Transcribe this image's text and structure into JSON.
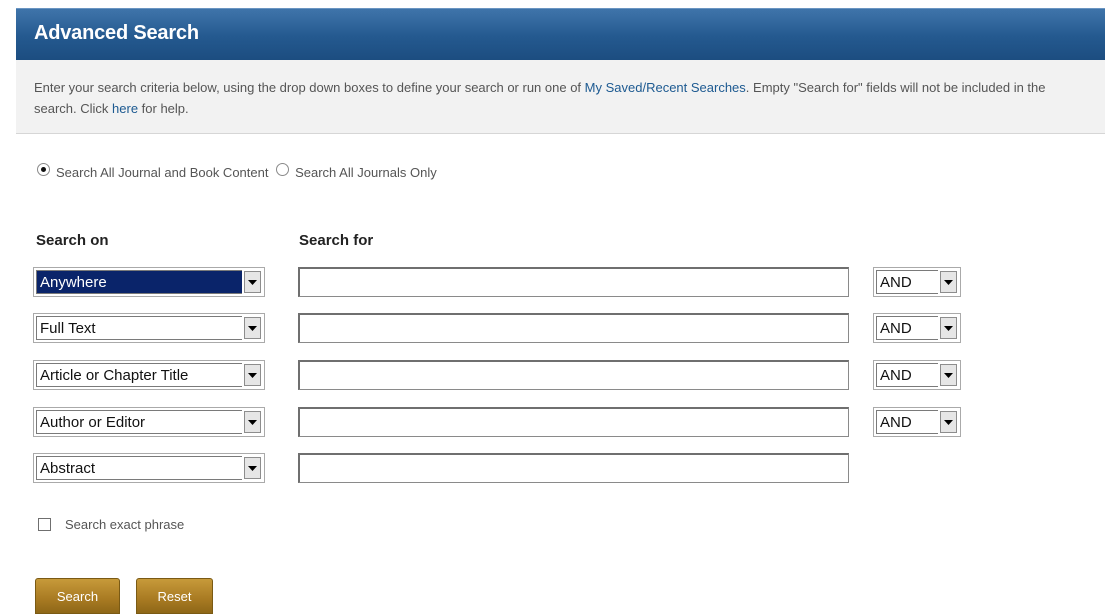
{
  "header": {
    "title": "Advanced Search"
  },
  "intro": {
    "text_before": "Enter your search criteria below, using the drop down boxes to define your search or run one of ",
    "saved_link": "My Saved/Recent Searches",
    "text_middle": ". Empty \"Search for\" fields will not be included in the search. Click ",
    "help_link": "here",
    "text_after": " for help."
  },
  "scope": {
    "options": [
      {
        "label": "Search All Journal and Book Content",
        "checked": true
      },
      {
        "label": "Search All Journals Only",
        "checked": false
      }
    ]
  },
  "columns": {
    "search_on": "Search on",
    "search_for": "Search for"
  },
  "rows": [
    {
      "field": "Anywhere",
      "highlighted": true,
      "term": "",
      "operator": "AND"
    },
    {
      "field": "Full Text",
      "highlighted": false,
      "term": "",
      "operator": "AND"
    },
    {
      "field": "Article or Chapter Title",
      "highlighted": false,
      "term": "",
      "operator": "AND"
    },
    {
      "field": "Author or Editor",
      "highlighted": false,
      "term": "",
      "operator": "AND"
    },
    {
      "field": "Abstract",
      "highlighted": false,
      "term": ""
    }
  ],
  "exact_phrase": {
    "label": "Search exact phrase",
    "checked": false
  },
  "buttons": {
    "search": "Search",
    "reset": "Reset"
  },
  "colors": {
    "header": "#24598f",
    "link": "#1d5a91",
    "button": "#a87a22",
    "selection": "#0a246a"
  }
}
